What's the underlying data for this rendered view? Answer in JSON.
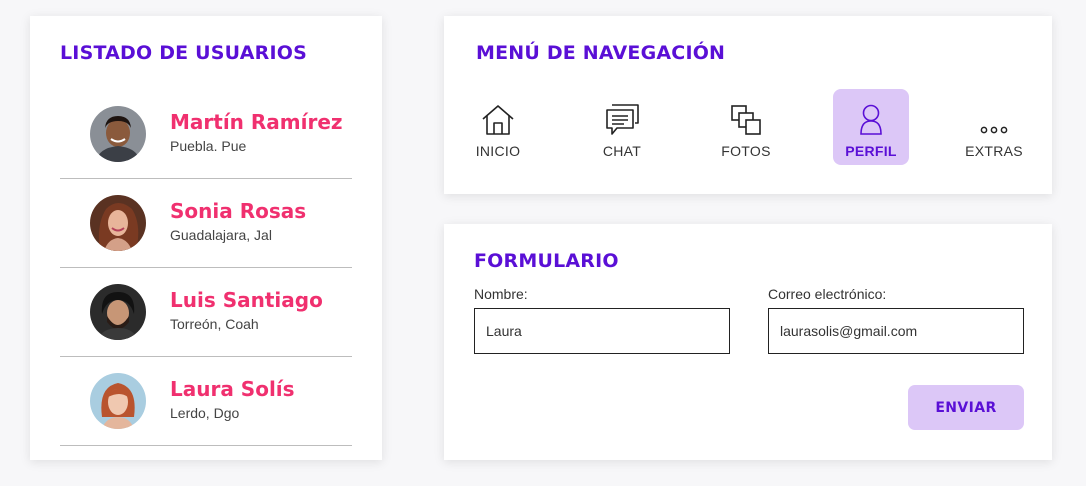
{
  "users_card": {
    "title": "LISTADO DE USUARIOS",
    "users": [
      {
        "name": "Martín Ramírez",
        "location": "Puebla. Pue"
      },
      {
        "name": "Sonia Rosas",
        "location": "Guadalajara, Jal"
      },
      {
        "name": "Luis Santiago",
        "location": "Torreón, Coah"
      },
      {
        "name": "Laura Solís",
        "location": "Lerdo, Dgo"
      }
    ]
  },
  "nav_card": {
    "title": "MENÚ DE NAVEGACIÓN",
    "items": [
      {
        "label": "INICIO",
        "icon": "home-icon"
      },
      {
        "label": "CHAT",
        "icon": "chat-icon"
      },
      {
        "label": "FOTOS",
        "icon": "photos-icon"
      },
      {
        "label": "PERFIL",
        "icon": "user-icon",
        "active": true
      },
      {
        "label": "EXTRAS",
        "icon": "more-icon"
      }
    ]
  },
  "form_card": {
    "title": "FORMULARIO",
    "name_label": "Nombre:",
    "name_value": "Laura",
    "email_label": "Correo electrónico:",
    "email_value": "laurasolis@gmail.com",
    "submit_label": "ENVIAR"
  },
  "colors": {
    "accent": "#5a0fd6",
    "name_pink": "#f0306f",
    "highlight": "#dcc7f7"
  }
}
